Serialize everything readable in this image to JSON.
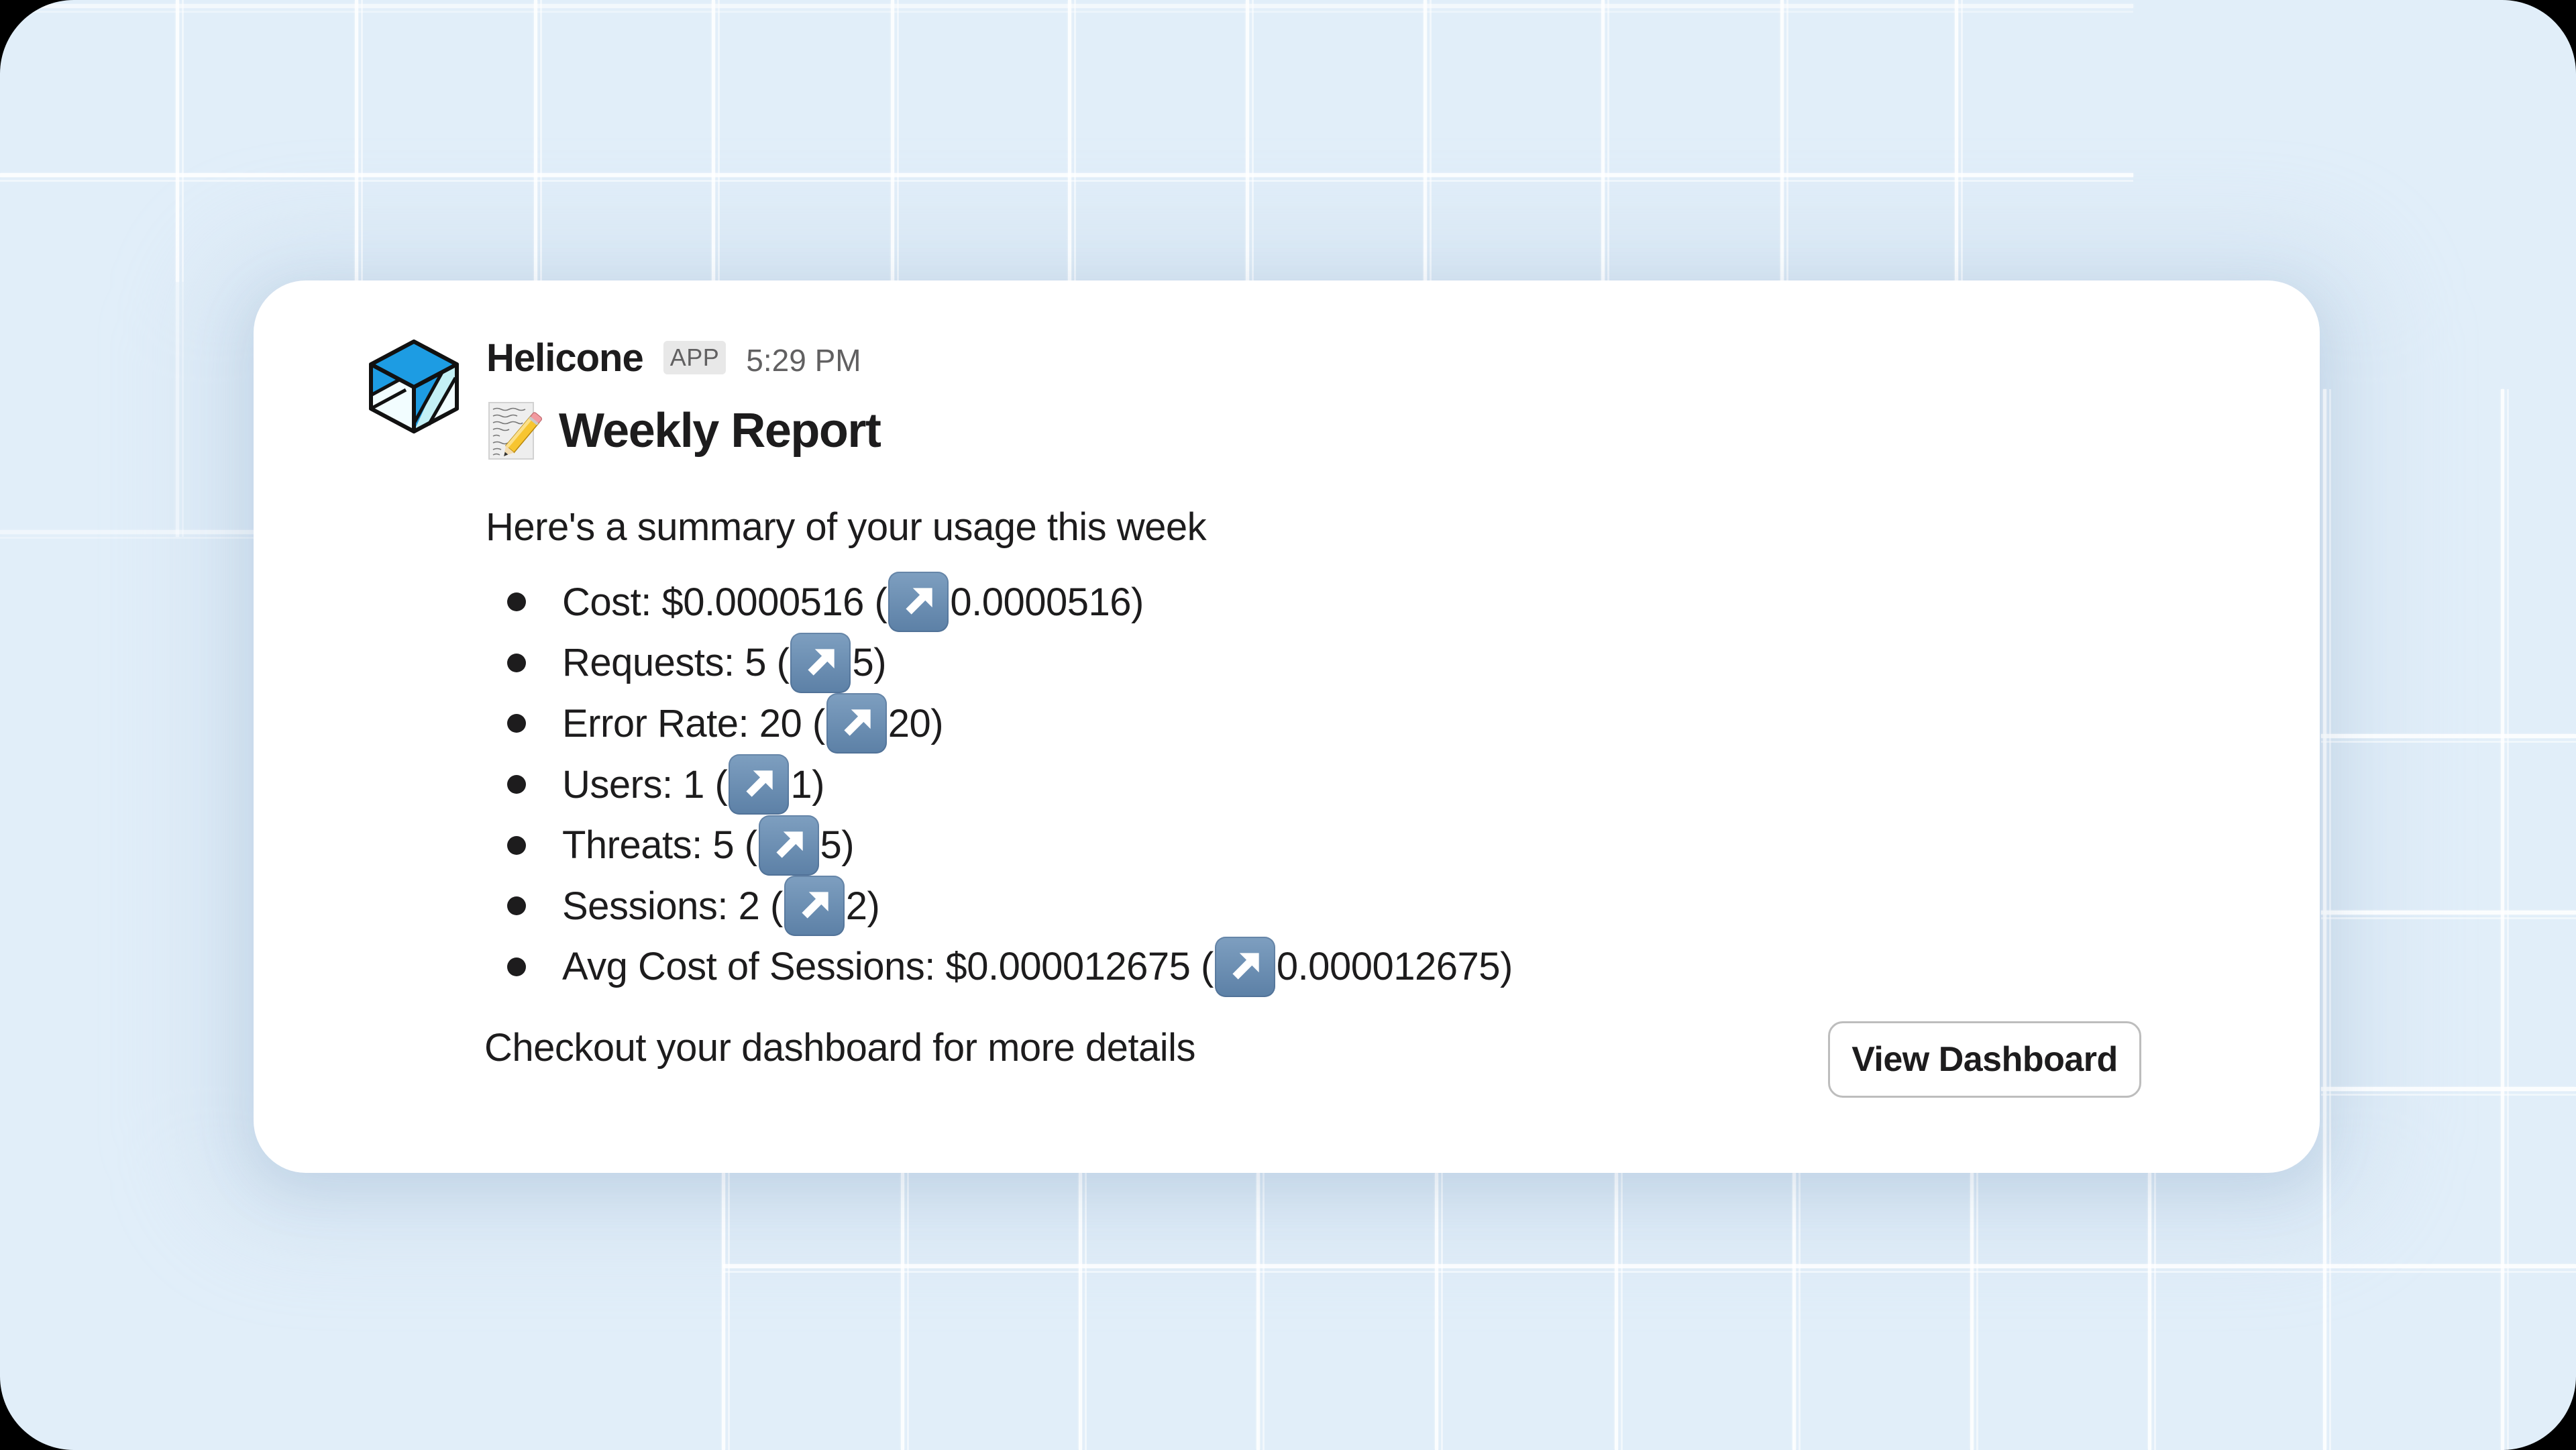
{
  "message": {
    "sender": "Helicone",
    "badge": "APP",
    "time": "5:29 PM",
    "logo_icon": "helicone-cube-logo",
    "title_icon": "memo-emoji",
    "title": "Weekly Report",
    "intro": "Here's a summary of your usage this week",
    "metrics": [
      {
        "label": "Cost: $0.0000516 (",
        "trend_icon": "up-right-arrow-emoji",
        "change": " 0.0000516)"
      },
      {
        "label": "Requests: 5 (",
        "trend_icon": "up-right-arrow-emoji",
        "change": " 5)"
      },
      {
        "label": "Error Rate: 20 (",
        "trend_icon": "up-right-arrow-emoji",
        "change": " 20)"
      },
      {
        "label": "Users: 1 (",
        "trend_icon": "up-right-arrow-emoji",
        "change": " 1)"
      },
      {
        "label": "Threats: 5 (",
        "trend_icon": "up-right-arrow-emoji",
        "change": " 5)"
      },
      {
        "label": "Sessions: 2 (",
        "trend_icon": "up-right-arrow-emoji",
        "change": " 2)"
      },
      {
        "label": "Avg Cost of Sessions: $0.000012675 (",
        "trend_icon": "up-right-arrow-emoji",
        "change": " 0.000012675)"
      }
    ],
    "outro": "Checkout your dashboard for more details",
    "button_label": "View Dashboard"
  },
  "colors": {
    "background": "#e1eef9",
    "card": "#ffffff",
    "text": "#1d1c1d",
    "muted": "#616061",
    "logo_blue": "#1d9ce3",
    "logo_light": "#c3f0f5",
    "arrow_emoji_bg": "#6e91b5"
  }
}
